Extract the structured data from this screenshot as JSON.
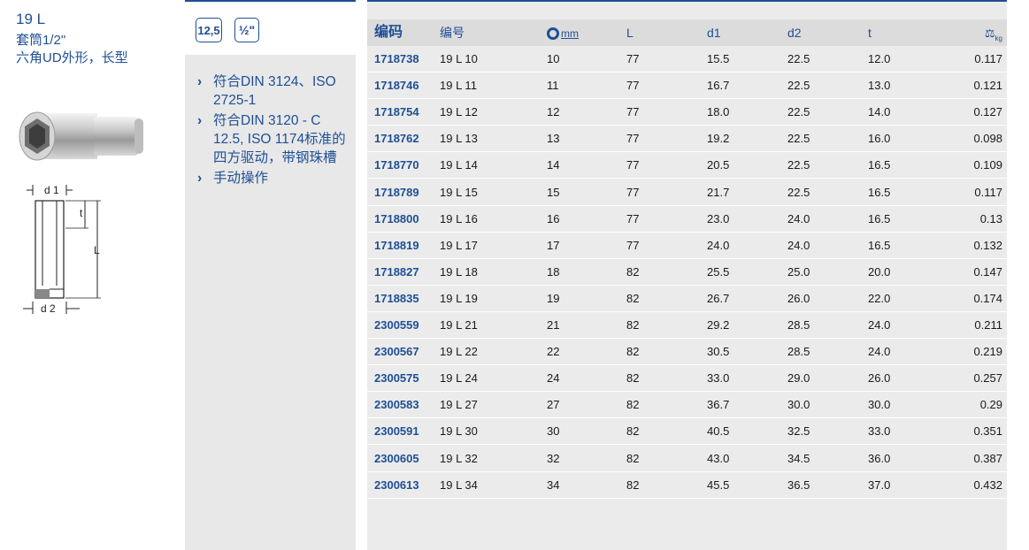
{
  "product": {
    "title": "19 L",
    "subtitle_lines": [
      "套筒1/2\"",
      "六角UD外形，长型"
    ]
  },
  "diagram": {
    "d1": "d 1",
    "d2": "d 2",
    "t": "t",
    "L": "L"
  },
  "badges": {
    "size": "12,5",
    "drive": "½\""
  },
  "features": [
    {
      "chev": "›",
      "text": "符合DIN 3124、ISO 2725-1"
    },
    {
      "chev": "›",
      "text": "符合DIN 3120 - C 12.5, ISO 1174标准的四方驱动，带钢珠槽"
    },
    {
      "chev": "›",
      "text": "手动操作"
    }
  ],
  "table": {
    "headers": {
      "code": "编码",
      "number": "编号",
      "mm": "mm",
      "L": "L",
      "d1": "d1",
      "d2": "d2",
      "t": "t",
      "kg": "kg"
    },
    "rows": [
      [
        "1718738",
        "19 L 10",
        "10",
        "77",
        "15.5",
        "22.5",
        "12.0",
        "0.117"
      ],
      [
        "1718746",
        "19 L 11",
        "11",
        "77",
        "16.7",
        "22.5",
        "13.0",
        "0.121"
      ],
      [
        "1718754",
        "19 L 12",
        "12",
        "77",
        "18.0",
        "22.5",
        "14.0",
        "0.127"
      ],
      [
        "1718762",
        "19 L 13",
        "13",
        "77",
        "19.2",
        "22.5",
        "16.0",
        "0.098"
      ],
      [
        "1718770",
        "19 L 14",
        "14",
        "77",
        "20.5",
        "22.5",
        "16.5",
        "0.109"
      ],
      [
        "1718789",
        "19 L 15",
        "15",
        "77",
        "21.7",
        "22.5",
        "16.5",
        "0.117"
      ],
      [
        "1718800",
        "19 L 16",
        "16",
        "77",
        "23.0",
        "24.0",
        "16.5",
        "0.13"
      ],
      [
        "1718819",
        "19 L 17",
        "17",
        "77",
        "24.0",
        "24.0",
        "16.5",
        "0.132"
      ],
      [
        "1718827",
        "19 L 18",
        "18",
        "82",
        "25.5",
        "25.0",
        "20.0",
        "0.147"
      ],
      [
        "1718835",
        "19 L 19",
        "19",
        "82",
        "26.7",
        "26.0",
        "22.0",
        "0.174"
      ],
      [
        "2300559",
        "19 L 21",
        "21",
        "82",
        "29.2",
        "28.5",
        "24.0",
        "0.211"
      ],
      [
        "2300567",
        "19 L 22",
        "22",
        "82",
        "30.5",
        "28.5",
        "24.0",
        "0.219"
      ],
      [
        "2300575",
        "19 L 24",
        "24",
        "82",
        "33.0",
        "29.0",
        "26.0",
        "0.257"
      ],
      [
        "2300583",
        "19 L 27",
        "27",
        "82",
        "36.7",
        "30.0",
        "30.0",
        "0.29"
      ],
      [
        "2300591",
        "19 L 30",
        "30",
        "82",
        "40.5",
        "32.5",
        "33.0",
        "0.351"
      ],
      [
        "2300605",
        "19 L 32",
        "32",
        "82",
        "43.0",
        "34.5",
        "36.0",
        "0.387"
      ],
      [
        "2300613",
        "19 L 34",
        "34",
        "82",
        "45.5",
        "36.5",
        "37.0",
        "0.432"
      ]
    ]
  },
  "colors": {
    "accent": "#1f4f94",
    "panel": "#e8e8e8",
    "header_bg": "#dcdcdc"
  }
}
